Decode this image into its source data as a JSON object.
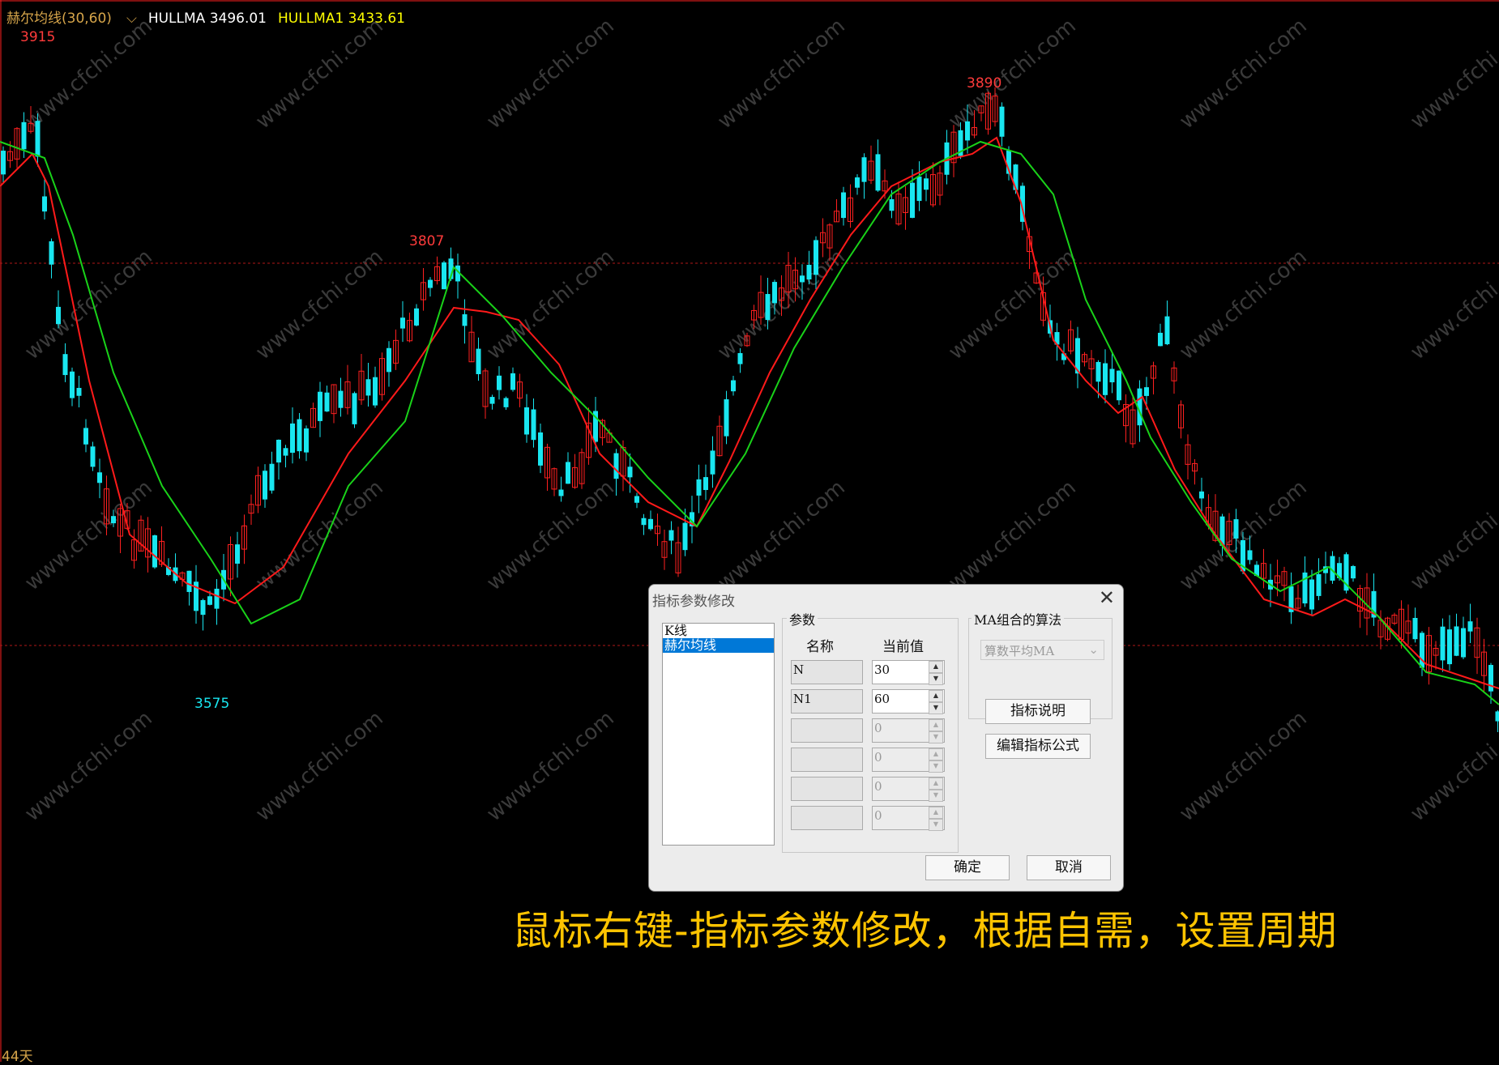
{
  "legend": {
    "indicator_name": "赫尔均线(30,60)",
    "dropdown_glyph": "⌵",
    "hullma": "HULLMA 3496.01",
    "hullma1": "HULLMA1 3433.61"
  },
  "chart_data": {
    "type": "candlestick",
    "price_labels": [
      {
        "value": "3915",
        "color": "#ff3b3b"
      },
      {
        "value": "3807",
        "color": "#ff3b3b"
      },
      {
        "value": "3890",
        "color": "#ff3b3b"
      },
      {
        "value": "3575",
        "color": "#19e6f0"
      }
    ],
    "reference_lines": [
      3780,
      3640
    ],
    "series": [
      {
        "name": "HULLMA",
        "color": "#ff1a1a"
      },
      {
        "name": "HULLMA1",
        "color": "#19d219"
      }
    ],
    "colors": {
      "up": "#ff2020",
      "down": "#19e6f0",
      "watermark": "#3a3a3a"
    }
  },
  "watermark": "www.cfchi.com",
  "footer": {
    "days": "44天"
  },
  "caption": "鼠标右键-指标参数修改，根据自需，设置周期",
  "dialog": {
    "title": "指标参数修改",
    "close": "✕",
    "indicators": [
      "K线",
      "赫尔均线"
    ],
    "params_group": "参数",
    "col_name": "名称",
    "col_value": "当前值",
    "params": [
      {
        "name": "N",
        "value": "30"
      },
      {
        "name": "N1",
        "value": "60"
      },
      {
        "name": "",
        "value": "0"
      },
      {
        "name": "",
        "value": "0"
      },
      {
        "name": "",
        "value": "0"
      },
      {
        "name": "",
        "value": "0"
      }
    ],
    "ma_group": "MA组合的算法",
    "ma_select": "算数平均MA",
    "btn_explain": "指标说明",
    "btn_edit": "编辑指标公式",
    "btn_ok": "确定",
    "btn_cancel": "取消"
  }
}
